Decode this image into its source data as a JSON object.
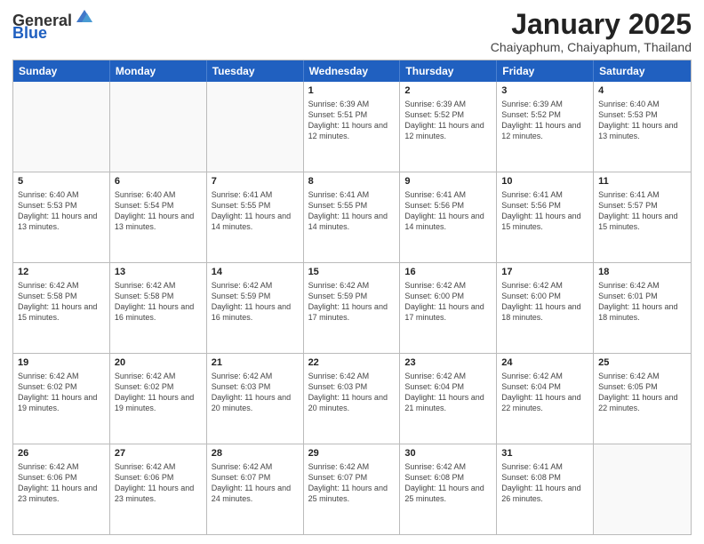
{
  "logo": {
    "general": "General",
    "blue": "Blue"
  },
  "title": "January 2025",
  "location": "Chaiyaphum, Chaiyaphum, Thailand",
  "weekdays": [
    "Sunday",
    "Monday",
    "Tuesday",
    "Wednesday",
    "Thursday",
    "Friday",
    "Saturday"
  ],
  "rows": [
    [
      {
        "day": "",
        "info": ""
      },
      {
        "day": "",
        "info": ""
      },
      {
        "day": "",
        "info": ""
      },
      {
        "day": "1",
        "info": "Sunrise: 6:39 AM\nSunset: 5:51 PM\nDaylight: 11 hours and 12 minutes."
      },
      {
        "day": "2",
        "info": "Sunrise: 6:39 AM\nSunset: 5:52 PM\nDaylight: 11 hours and 12 minutes."
      },
      {
        "day": "3",
        "info": "Sunrise: 6:39 AM\nSunset: 5:52 PM\nDaylight: 11 hours and 12 minutes."
      },
      {
        "day": "4",
        "info": "Sunrise: 6:40 AM\nSunset: 5:53 PM\nDaylight: 11 hours and 13 minutes."
      }
    ],
    [
      {
        "day": "5",
        "info": "Sunrise: 6:40 AM\nSunset: 5:53 PM\nDaylight: 11 hours and 13 minutes."
      },
      {
        "day": "6",
        "info": "Sunrise: 6:40 AM\nSunset: 5:54 PM\nDaylight: 11 hours and 13 minutes."
      },
      {
        "day": "7",
        "info": "Sunrise: 6:41 AM\nSunset: 5:55 PM\nDaylight: 11 hours and 14 minutes."
      },
      {
        "day": "8",
        "info": "Sunrise: 6:41 AM\nSunset: 5:55 PM\nDaylight: 11 hours and 14 minutes."
      },
      {
        "day": "9",
        "info": "Sunrise: 6:41 AM\nSunset: 5:56 PM\nDaylight: 11 hours and 14 minutes."
      },
      {
        "day": "10",
        "info": "Sunrise: 6:41 AM\nSunset: 5:56 PM\nDaylight: 11 hours and 15 minutes."
      },
      {
        "day": "11",
        "info": "Sunrise: 6:41 AM\nSunset: 5:57 PM\nDaylight: 11 hours and 15 minutes."
      }
    ],
    [
      {
        "day": "12",
        "info": "Sunrise: 6:42 AM\nSunset: 5:58 PM\nDaylight: 11 hours and 15 minutes."
      },
      {
        "day": "13",
        "info": "Sunrise: 6:42 AM\nSunset: 5:58 PM\nDaylight: 11 hours and 16 minutes."
      },
      {
        "day": "14",
        "info": "Sunrise: 6:42 AM\nSunset: 5:59 PM\nDaylight: 11 hours and 16 minutes."
      },
      {
        "day": "15",
        "info": "Sunrise: 6:42 AM\nSunset: 5:59 PM\nDaylight: 11 hours and 17 minutes."
      },
      {
        "day": "16",
        "info": "Sunrise: 6:42 AM\nSunset: 6:00 PM\nDaylight: 11 hours and 17 minutes."
      },
      {
        "day": "17",
        "info": "Sunrise: 6:42 AM\nSunset: 6:00 PM\nDaylight: 11 hours and 18 minutes."
      },
      {
        "day": "18",
        "info": "Sunrise: 6:42 AM\nSunset: 6:01 PM\nDaylight: 11 hours and 18 minutes."
      }
    ],
    [
      {
        "day": "19",
        "info": "Sunrise: 6:42 AM\nSunset: 6:02 PM\nDaylight: 11 hours and 19 minutes."
      },
      {
        "day": "20",
        "info": "Sunrise: 6:42 AM\nSunset: 6:02 PM\nDaylight: 11 hours and 19 minutes."
      },
      {
        "day": "21",
        "info": "Sunrise: 6:42 AM\nSunset: 6:03 PM\nDaylight: 11 hours and 20 minutes."
      },
      {
        "day": "22",
        "info": "Sunrise: 6:42 AM\nSunset: 6:03 PM\nDaylight: 11 hours and 20 minutes."
      },
      {
        "day": "23",
        "info": "Sunrise: 6:42 AM\nSunset: 6:04 PM\nDaylight: 11 hours and 21 minutes."
      },
      {
        "day": "24",
        "info": "Sunrise: 6:42 AM\nSunset: 6:04 PM\nDaylight: 11 hours and 22 minutes."
      },
      {
        "day": "25",
        "info": "Sunrise: 6:42 AM\nSunset: 6:05 PM\nDaylight: 11 hours and 22 minutes."
      }
    ],
    [
      {
        "day": "26",
        "info": "Sunrise: 6:42 AM\nSunset: 6:06 PM\nDaylight: 11 hours and 23 minutes."
      },
      {
        "day": "27",
        "info": "Sunrise: 6:42 AM\nSunset: 6:06 PM\nDaylight: 11 hours and 23 minutes."
      },
      {
        "day": "28",
        "info": "Sunrise: 6:42 AM\nSunset: 6:07 PM\nDaylight: 11 hours and 24 minutes."
      },
      {
        "day": "29",
        "info": "Sunrise: 6:42 AM\nSunset: 6:07 PM\nDaylight: 11 hours and 25 minutes."
      },
      {
        "day": "30",
        "info": "Sunrise: 6:42 AM\nSunset: 6:08 PM\nDaylight: 11 hours and 25 minutes."
      },
      {
        "day": "31",
        "info": "Sunrise: 6:41 AM\nSunset: 6:08 PM\nDaylight: 11 hours and 26 minutes."
      },
      {
        "day": "",
        "info": ""
      }
    ]
  ]
}
